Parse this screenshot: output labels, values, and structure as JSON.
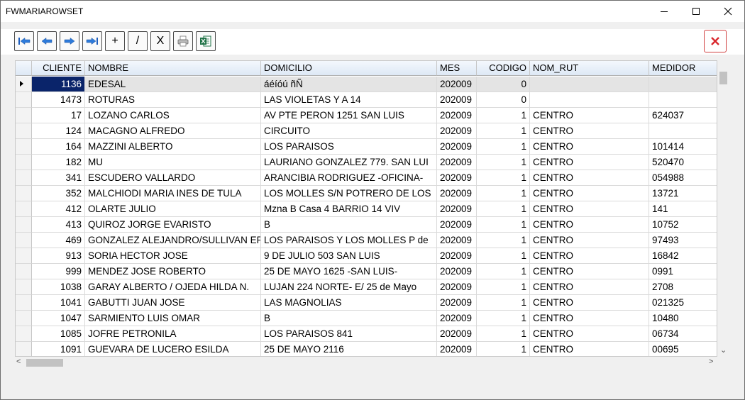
{
  "window": {
    "title": "FWMARIAROWSET"
  },
  "toolbar": {
    "buttons": [
      {
        "name": "first-record-button",
        "icon": "first-record-icon",
        "label": ""
      },
      {
        "name": "prev-record-button",
        "icon": "arrow-left-icon",
        "label": ""
      },
      {
        "name": "next-record-button",
        "icon": "arrow-right-icon",
        "label": ""
      },
      {
        "name": "last-record-button",
        "icon": "last-record-icon",
        "label": ""
      },
      {
        "name": "add-button",
        "icon": "",
        "label": "+"
      },
      {
        "name": "edit-button",
        "icon": "",
        "label": "/"
      },
      {
        "name": "delete-button",
        "icon": "",
        "label": "X"
      },
      {
        "name": "print-button",
        "icon": "printer-icon",
        "label": ""
      },
      {
        "name": "excel-button",
        "icon": "excel-icon",
        "label": ""
      }
    ]
  },
  "grid": {
    "columns": [
      {
        "label": "CLIENTE",
        "align": "right"
      },
      {
        "label": "NOMBRE",
        "align": "left"
      },
      {
        "label": "DOMICILIO",
        "align": "left"
      },
      {
        "label": "MES",
        "align": "left"
      },
      {
        "label": "CODIGO",
        "align": "right"
      },
      {
        "label": "NOM_RUT",
        "align": "left"
      },
      {
        "label": "MEDIDOR",
        "align": "left"
      }
    ],
    "rows": [
      [
        "1136",
        "EDESAL",
        "áéíóú ñÑ",
        "202009",
        "0",
        "",
        ""
      ],
      [
        "1473",
        "ROTURAS",
        "LAS  VIOLETAS Y A 14",
        "202009",
        "0",
        "",
        ""
      ],
      [
        "17",
        "LOZANO CARLOS",
        "AV PTE PERON 1251 SAN LUIS",
        "202009",
        "1",
        "CENTRO",
        "624037"
      ],
      [
        "124",
        "MACAGNO ALFREDO",
        "CIRCUITO",
        "202009",
        "1",
        "CENTRO",
        ""
      ],
      [
        "164",
        "MAZZINI ALBERTO",
        "LOS  PARAISOS",
        "202009",
        "1",
        "CENTRO",
        "101414"
      ],
      [
        "182",
        "MU",
        "LAURIANO GONZALEZ 779. SAN LUI",
        "202009",
        "1",
        "CENTRO",
        "520470"
      ],
      [
        "341",
        "ESCUDERO VALLARDO",
        "ARANCIBIA RODRIGUEZ -OFICINA-",
        "202009",
        "1",
        "CENTRO",
        "054988"
      ],
      [
        "352",
        "MALCHIODI MARIA INES DE TULA",
        "LOS MOLLES S/N POTRERO DE LOS",
        "202009",
        "1",
        "CENTRO",
        "13721"
      ],
      [
        "412",
        "OLARTE JULIO",
        "Mzna  B  Casa  4 BARRIO 14 VIV",
        "202009",
        "1",
        "CENTRO",
        "141"
      ],
      [
        "413",
        "QUIROZ JORGE EVARISTO",
        "B",
        "202009",
        "1",
        "CENTRO",
        "10752"
      ],
      [
        "469",
        "GONZALEZ ALEJANDRO/SULLIVAN ER",
        "LOS PARAISOS Y LOS MOLLES P de",
        "202009",
        "1",
        "CENTRO",
        "97493"
      ],
      [
        "913",
        "SORIA HECTOR JOSE",
        "9 DE JULIO 503 SAN LUIS",
        "202009",
        "1",
        "CENTRO",
        "16842"
      ],
      [
        "999",
        "MENDEZ JOSE ROBERTO",
        "25 DE MAYO 1625 -SAN LUIS-",
        "202009",
        "1",
        "CENTRO",
        "0991"
      ],
      [
        "1038",
        "GARAY ALBERTO / OJEDA HILDA N.",
        "LUJAN 224 NORTE- E/ 25 de Mayo",
        "202009",
        "1",
        "CENTRO",
        "2708"
      ],
      [
        "1041",
        "GABUTTI JUAN JOSE",
        "LAS MAGNOLIAS",
        "202009",
        "1",
        "CENTRO",
        "021325"
      ],
      [
        "1047",
        "SARMIENTO LUIS OMAR",
        "B",
        "202009",
        "1",
        "CENTRO",
        "10480"
      ],
      [
        "1085",
        "JOFRE PETRONILA",
        "LOS  PARAISOS 841",
        "202009",
        "1",
        "CENTRO",
        "06734"
      ],
      [
        "1091",
        "GUEVARA DE LUCERO ESILDA",
        "25 DE MAYO 2116",
        "202009",
        "1",
        "CENTRO",
        "00695"
      ]
    ]
  },
  "colors": {
    "selected_cell": "#0a246a",
    "header_bg": "#dde8f5",
    "close_red": "#d9262c",
    "excel_green": "#1e7145"
  }
}
